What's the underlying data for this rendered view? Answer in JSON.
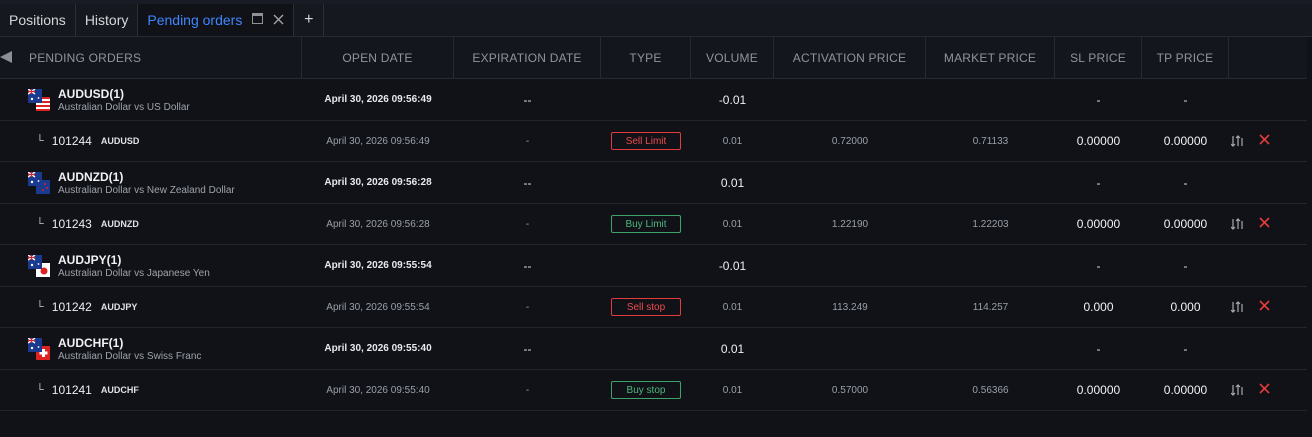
{
  "tabs": [
    {
      "label": "Positions",
      "active": false
    },
    {
      "label": "History",
      "active": false
    },
    {
      "label": "Pending orders",
      "active": true
    }
  ],
  "add_tab_label": "+",
  "columns": [
    "PENDING ORDERS",
    "OPEN DATE",
    "EXPIRATION DATE",
    "TYPE",
    "VOLUME",
    "ACTIVATION PRICE",
    "MARKET PRICE",
    "SL PRICE",
    "TP PRICE"
  ],
  "groups": [
    {
      "symbol": "AUDUSD(1)",
      "description": "Australian Dollar vs US Dollar",
      "open_date": "April 30, 2026 09:56:49",
      "expiration": "--",
      "volume": "-0.01",
      "sl": "-",
      "tp": "-",
      "flag": "usd",
      "order": {
        "id": "101244",
        "symbol": "AUDUSD",
        "open_date": "April 30, 2026 09:56:49",
        "expiration": "-",
        "type": "Sell Limit",
        "side": "sell",
        "volume": "0.01",
        "activation_price": "0.72000",
        "market_price": "0.71133",
        "sl": "0.00000",
        "tp": "0.00000"
      }
    },
    {
      "symbol": "AUDNZD(1)",
      "description": "Australian Dollar vs New Zealand Dollar",
      "open_date": "April 30, 2026 09:56:28",
      "expiration": "--",
      "volume": "0.01",
      "sl": "-",
      "tp": "-",
      "flag": "nzd",
      "order": {
        "id": "101243",
        "symbol": "AUDNZD",
        "open_date": "April 30, 2026 09:56:28",
        "expiration": "-",
        "type": "Buy Limit",
        "side": "buy",
        "volume": "0.01",
        "activation_price": "1.22190",
        "market_price": "1.22203",
        "sl": "0.00000",
        "tp": "0.00000"
      }
    },
    {
      "symbol": "AUDJPY(1)",
      "description": "Australian Dollar vs Japanese Yen",
      "open_date": "April 30, 2026 09:55:54",
      "expiration": "--",
      "volume": "-0.01",
      "sl": "-",
      "tp": "-",
      "flag": "jpy",
      "order": {
        "id": "101242",
        "symbol": "AUDJPY",
        "open_date": "April 30, 2026 09:55:54",
        "expiration": "-",
        "type": "Sell stop",
        "side": "sell",
        "volume": "0.01",
        "activation_price": "113.249",
        "market_price": "114.257",
        "sl": "0.000",
        "tp": "0.000"
      }
    },
    {
      "symbol": "AUDCHF(1)",
      "description": "Australian Dollar vs Swiss Franc",
      "open_date": "April 30, 2026 09:55:40",
      "expiration": "--",
      "volume": "0.01",
      "sl": "-",
      "tp": "-",
      "flag": "chf",
      "order": {
        "id": "101241",
        "symbol": "AUDCHF",
        "open_date": "April 30, 2026 09:55:40",
        "expiration": "-",
        "type": "Buy stop",
        "side": "buy",
        "volume": "0.01",
        "activation_price": "0.57000",
        "market_price": "0.56366",
        "sl": "0.00000",
        "tp": "0.00000"
      }
    }
  ],
  "icons": {
    "tab_popout": "window-icon",
    "tab_close": "close-icon",
    "modify": "modify-order-icon",
    "cancel": "cancel-order-icon"
  },
  "colors": {
    "accent": "#3f86ff",
    "sell": "#e23b3b",
    "buy": "#3ea36a",
    "background": "#101218"
  }
}
